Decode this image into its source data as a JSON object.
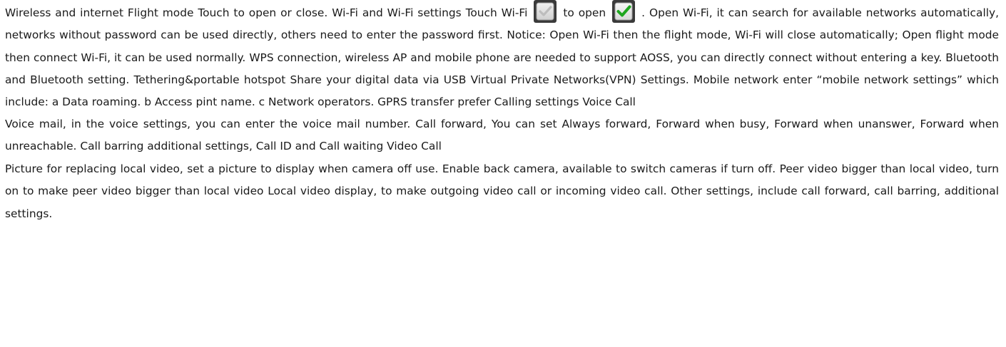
{
  "document": {
    "paragraph_1_parts": {
      "before_icon_1": "Wireless and internet Flight mode Touch to open or close. Wi-Fi and Wi-Fi settings Touch Wi-Fi",
      "between_icons": "to open",
      "after_icon_2": ". Open Wi-Fi, it can search for available networks automatically, networks without password can be used directly, others need to enter the password first. Notice: Open Wi-Fi then the flight mode, Wi-Fi will close automatically; Open flight mode then connect Wi-Fi, it can be used normally. WPS connection, wireless AP and mobile phone are needed to support AOSS, you can directly connect without entering a key. Bluetooth and Bluetooth setting. Tethering&portable hotspot Share your digital data via USB Virtual Private Networks(VPN) Settings. Mobile network enter “mobile network settings” which include: a Data roaming. b Access pint name. c Network operators. GPRS transfer prefer Calling settings Voice Call"
    },
    "paragraph_2": "Voice mail, in the voice settings, you can enter the voice mail number. Call forward, You can set Always forward, Forward when busy, Forward when unanswer, Forward when unreachable. Call barring additional settings, Call ID and Call waiting Video Call",
    "paragraph_3": "Picture for replacing local video, set a picture to display when camera off use. Enable back camera, available to switch cameras if turn off. Peer video bigger than local video, turn on to make peer video bigger than local video Local video display, to make outgoing video call or incoming video call. Other settings, include call forward, call barring, additional settings.",
    "icons": {
      "icon_1": "wifi-checkbox-unchecked-icon",
      "icon_2": "wifi-checkbox-checked-icon",
      "check_green": "#1fa61f",
      "check_grey": "#bdbdbd"
    }
  }
}
